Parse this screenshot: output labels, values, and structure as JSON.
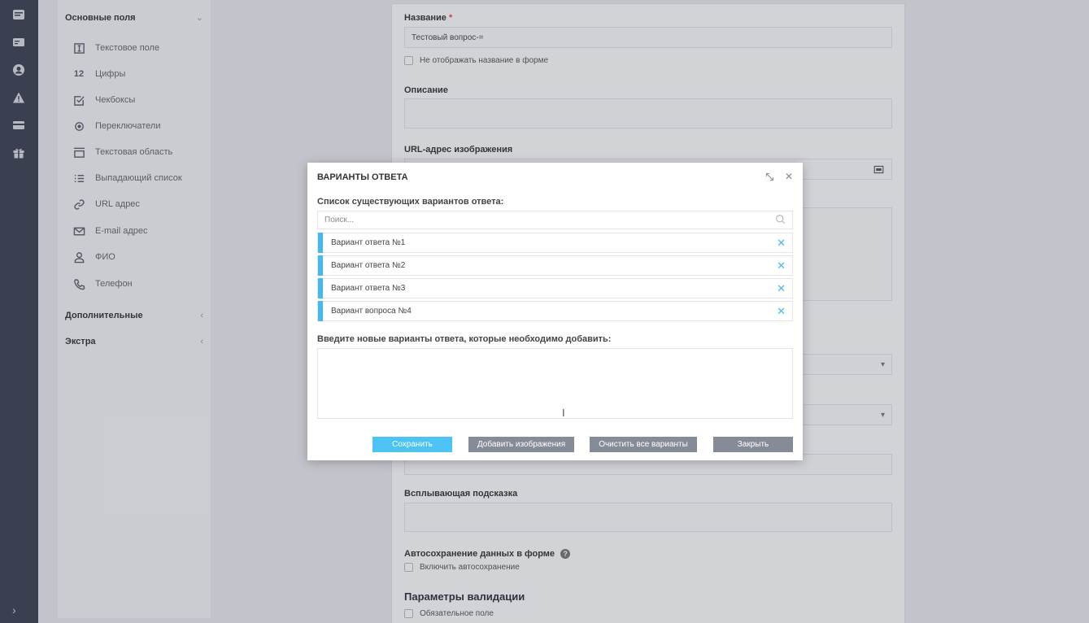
{
  "rail": {
    "icons": [
      "inbox-icon",
      "id-card-icon",
      "user-circle-icon",
      "warning-icon",
      "credit-card-icon",
      "gift-icon"
    ],
    "expand_glyph": "›"
  },
  "palette": {
    "main_group": "Основные поля",
    "items": [
      {
        "icon": "text-field-icon",
        "label": "Текстовое поле"
      },
      {
        "icon": "digits-icon",
        "glyph": "12",
        "label": "Цифры"
      },
      {
        "icon": "checkbox-icon",
        "label": "Чекбоксы"
      },
      {
        "icon": "radio-icon",
        "label": "Переключатели"
      },
      {
        "icon": "textarea-icon",
        "label": "Текстовая область"
      },
      {
        "icon": "list-icon",
        "label": "Выпадающий список"
      },
      {
        "icon": "link-icon",
        "label": "URL адрес"
      },
      {
        "icon": "mail-icon",
        "label": "E-mail адрес"
      },
      {
        "icon": "person-icon",
        "label": "ФИО"
      },
      {
        "icon": "phone-icon",
        "label": "Телефон"
      }
    ],
    "extra_group": "Дополнительные",
    "extra2_group": "Экстра"
  },
  "form": {
    "name_label": "Название",
    "required_mark": "*",
    "name_value": "Тестовый вопрос-=",
    "hide_name_label": "Не отображать название в форме",
    "description_label": "Описание",
    "image_url_label": "URL-адрес изображения",
    "tooltip_label": "Всплывающая подсказка",
    "autosave_label": "Автосохранение данных в форме",
    "autosave_help": "?",
    "autosave_check": "Включить автосохранение",
    "validation_head": "Параметры валидации",
    "required_check": "Обязательное поле"
  },
  "modal": {
    "title": "ВАРИАНТЫ ОТВЕТА",
    "existing_label": "Список существующих вариантов ответа:",
    "search_placeholder": "Поиск...",
    "options": [
      "Вариант ответа №1",
      "Вариант ответа №2",
      "Вариант ответа №3",
      "Вариант вопроса №4"
    ],
    "new_label": "Введите новые варианты ответа, которые необходимо добавить:",
    "new_value": "",
    "buttons": {
      "save": "Сохранить",
      "add_images": "Добавить изображения",
      "clear_all": "Очистить все варианты",
      "close": "Закрыть"
    }
  },
  "colors": {
    "accent": "#4cc3f2",
    "option_bar": "#45b8ec",
    "rail": "#3c4150",
    "button_gray": "#858b97"
  }
}
